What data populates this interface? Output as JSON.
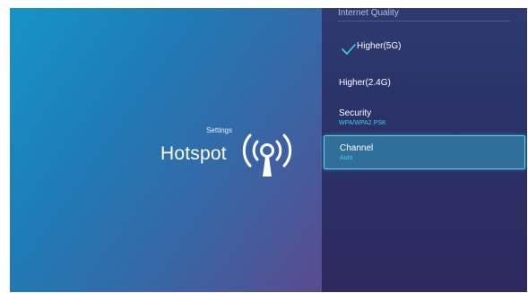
{
  "left": {
    "caption": "Settings",
    "title": "Hotspot",
    "icon": "wifi-hotspot-antenna-icon"
  },
  "menu": {
    "section_header": "Internet Quality",
    "items": [
      {
        "label": "Higher(5G)",
        "value": "",
        "selected": true,
        "icon": "checkmark-icon"
      },
      {
        "label": "Higher(2.4G)",
        "value": "",
        "selected": false
      },
      {
        "label": "Security",
        "value": "WPA/WPA2 PSK",
        "selected": false
      },
      {
        "label": "Channel",
        "value": "Auto",
        "focused": true
      }
    ]
  },
  "colors": {
    "accent": "#3fd0f2",
    "focus_border": "#59d2f0",
    "panel_right": "#2a3166"
  }
}
